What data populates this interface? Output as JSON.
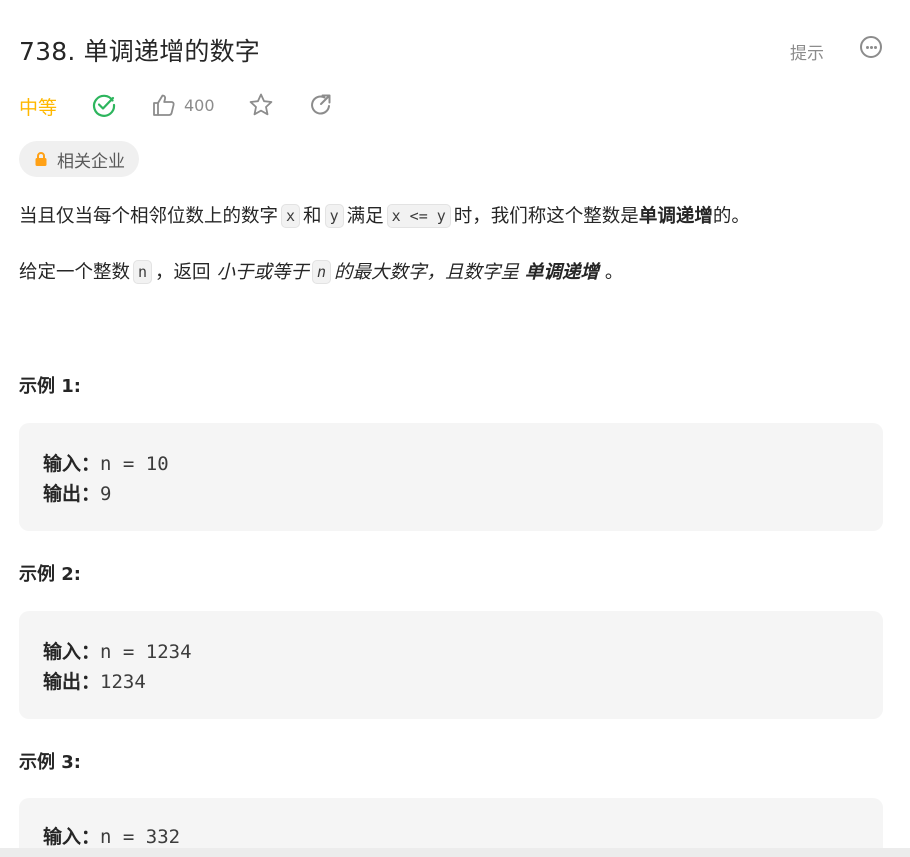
{
  "problem": {
    "title": "738. 单调递增的数字",
    "hint_label": "提示",
    "difficulty": "中等",
    "likes": "400",
    "company_chip": "相关企业"
  },
  "description": {
    "p1": {
      "t1": "当且仅当每个相邻位数上的数字",
      "c1": "x",
      "t2": "和",
      "c2": "y",
      "t3": "满足",
      "c3": "x <= y",
      "t4": "时，我们称这个整数是",
      "b1": "单调递增",
      "t5": "的。"
    },
    "p2": {
      "t1": "给定一个整数",
      "c1": "n",
      "t2": "，返回",
      "i1": "小于或等于",
      "c2": "n",
      "i2": "的最大数字，且数字呈",
      "b1": "单调递增",
      "t3": "。"
    }
  },
  "examples": [
    {
      "title": "示例 1:",
      "input_label": "输入：",
      "input": "n = 10",
      "output_label": "输出：",
      "output": "9"
    },
    {
      "title": "示例 2:",
      "input_label": "输入：",
      "input": "n = 1234",
      "output_label": "输出：",
      "output": "1234"
    },
    {
      "title": "示例 3:",
      "input_label": "输入：",
      "input": "n = 332"
    }
  ],
  "colors": {
    "difficulty": "#ffb800",
    "solved": "#2db55d",
    "lock": "#ffa116",
    "icon_gray": "#8c8c8c"
  },
  "icons": {
    "solved": "check-circle-icon",
    "like": "thumbs-up-icon",
    "favorite": "star-icon",
    "share": "share-arrow-icon",
    "more": "more-horizontal-icon",
    "lock": "lock-icon"
  }
}
